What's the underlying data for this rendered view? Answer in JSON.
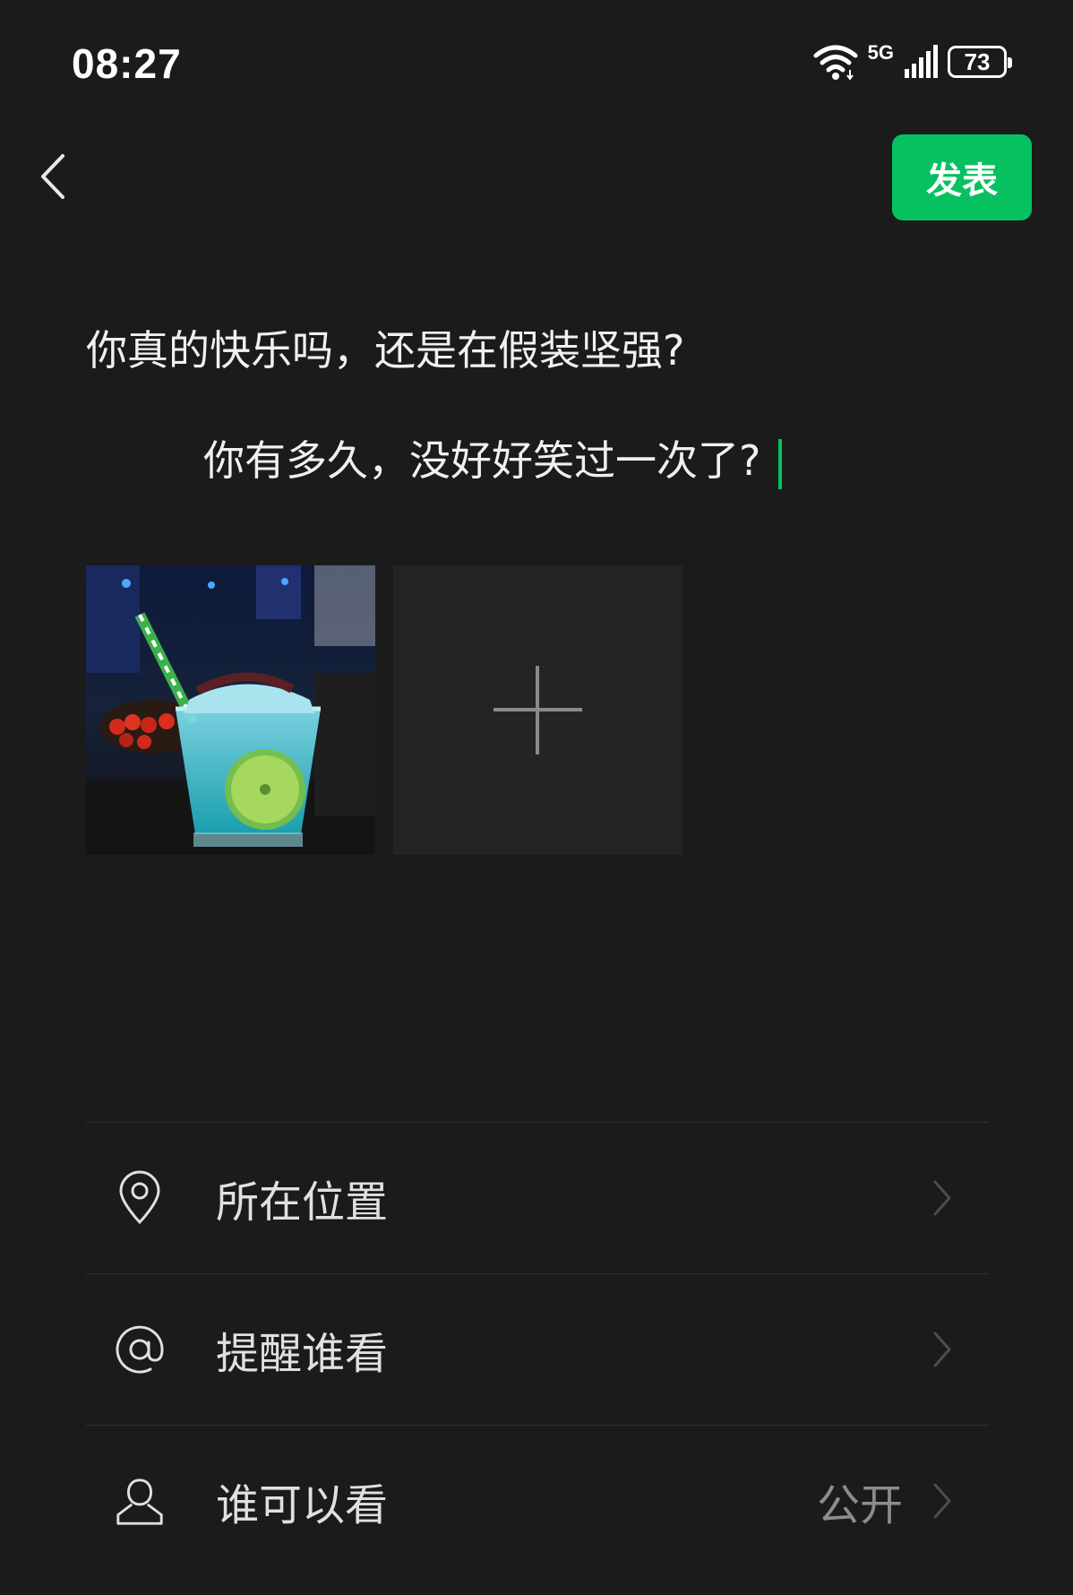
{
  "status_bar": {
    "time": "08:27",
    "network_label": "5G",
    "battery_level": "73",
    "icons": [
      "wifi-icon",
      "signal-icon",
      "battery-icon"
    ]
  },
  "header": {
    "back_icon": "chevron-left-icon",
    "post_label": "发表",
    "post_color": "#07c160"
  },
  "composer": {
    "lines": [
      "你真的快乐吗，还是在假装坚强?",
      "你有多久，没好好笑过一次了?"
    ],
    "caret_color": "#07c160"
  },
  "media": {
    "photos": [
      {
        "icon": "cocktail-photo"
      }
    ],
    "add_icon": "plus-icon"
  },
  "options": [
    {
      "icon": "location-pin-icon",
      "label": "所在位置",
      "value": ""
    },
    {
      "icon": "at-sign-icon",
      "label": "提醒谁看",
      "value": ""
    },
    {
      "icon": "person-icon",
      "label": "谁可以看",
      "value": "公开"
    }
  ],
  "colors": {
    "background": "#1b1b1b",
    "accent": "#07c160"
  }
}
